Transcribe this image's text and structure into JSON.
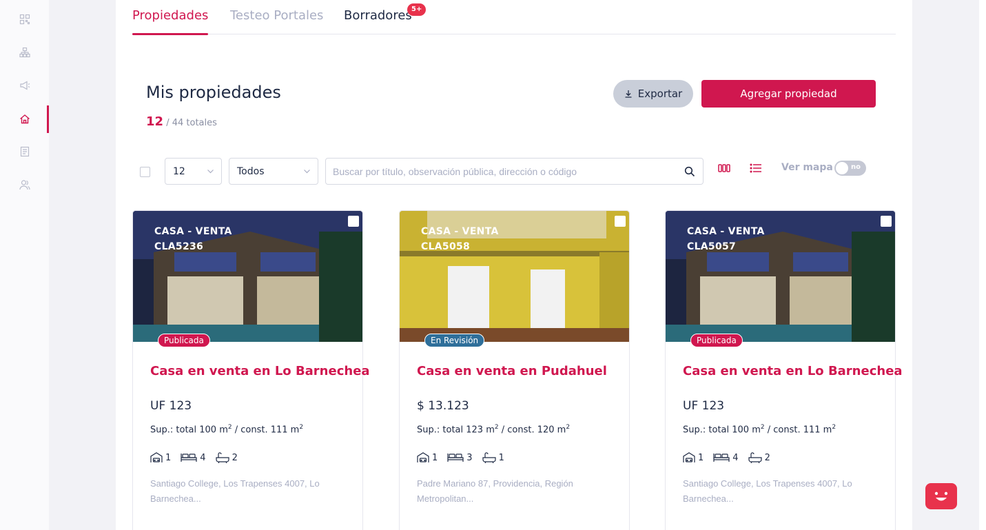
{
  "sidebar": {
    "items": [
      {
        "icon": "qr-grid-icon",
        "active": false
      },
      {
        "icon": "sitemap-icon",
        "active": false
      },
      {
        "icon": "megaphone-icon",
        "active": false
      },
      {
        "icon": "home-icon",
        "active": true
      },
      {
        "icon": "document-icon",
        "active": false
      },
      {
        "icon": "users-icon",
        "active": false
      }
    ]
  },
  "tabs": [
    {
      "label": "Propiedades",
      "state": "active"
    },
    {
      "label": "Testeo Portales",
      "state": "muted"
    },
    {
      "label": "Borradores",
      "state": "normal",
      "badge": "5+"
    }
  ],
  "header": {
    "title": "Mis propiedades",
    "count_shown": "12",
    "count_total": "/ 44 totales",
    "export_label": "Exportar",
    "add_label": "Agregar propiedad"
  },
  "filters": {
    "per_page": "12",
    "type": "Todos",
    "search_placeholder": "Buscar por título, observación pública, dirección o código",
    "map_label": "Ver mapa",
    "map_toggle": "no"
  },
  "cards": [
    {
      "kind": "CASA - VENTA",
      "code": "CLA5236",
      "status": "Publicada",
      "status_color": "#d0174f",
      "title": "Casa en venta en Lo Barnechea",
      "price": "UF 123",
      "sup_total": "Sup.: total 100 m",
      "sup_const": " / const. 111 m",
      "parking": "1",
      "bedrooms": "4",
      "bathrooms": "2",
      "address": "Santiago College, Los Trapenses 4007, Lo Barnechea..."
    },
    {
      "kind": "CASA - VENTA",
      "code": "CLA5058",
      "status": "En Revisión",
      "status_color": "#2f6f9a",
      "title": "Casa en venta en Pudahuel",
      "price": "$ 13.123",
      "sup_total": "Sup.: total 123 m",
      "sup_const": " / const. 120 m",
      "parking": "1",
      "bedrooms": "3",
      "bathrooms": "1",
      "address": "Padre Mariano 87, Providencia, Región Metropolitan..."
    },
    {
      "kind": "CASA - VENTA",
      "code": "CLA5057",
      "status": "Publicada",
      "status_color": "#d0174f",
      "title": "Casa en venta en Lo Barnechea",
      "price": "UF 123",
      "sup_total": "Sup.: total 100 m",
      "sup_const": " / const. 111 m",
      "parking": "1",
      "bedrooms": "4",
      "bathrooms": "2",
      "address": "Santiago College, Los Trapenses 4007, Lo Barnechea..."
    }
  ],
  "colors": {
    "brand": "#d0174f",
    "badge": "#e8324c",
    "muted": "#a9aec3"
  }
}
